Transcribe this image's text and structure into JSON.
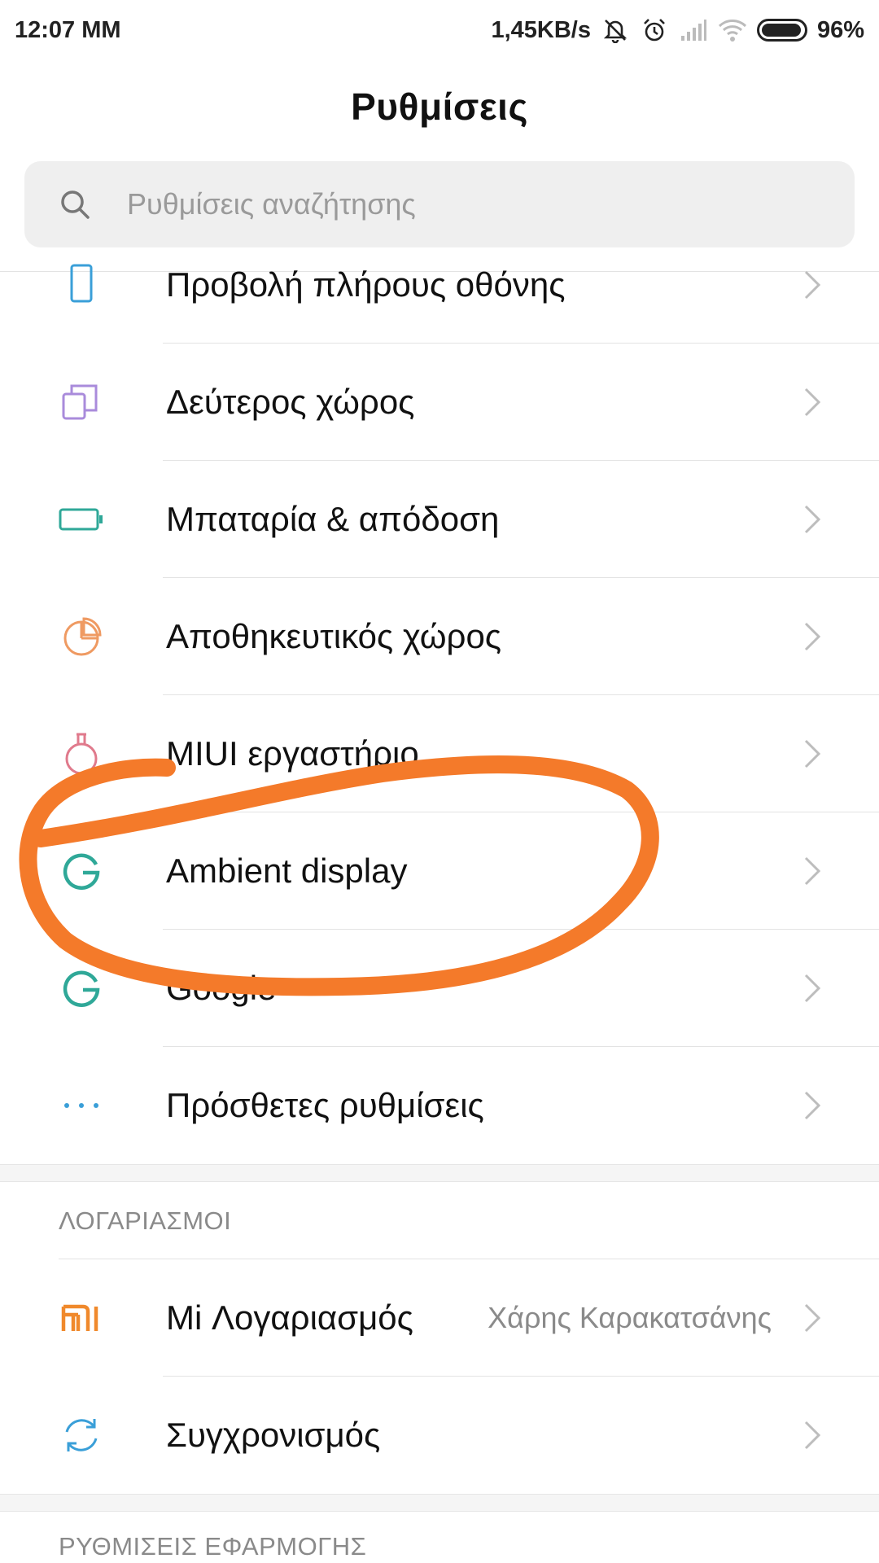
{
  "status_bar": {
    "time": "12:07 ΜΜ",
    "net_speed": "1,45KB/s",
    "battery_percent": "96%",
    "battery_level": 0.96
  },
  "page": {
    "title": "Ρυθμίσεις"
  },
  "search": {
    "placeholder": "Ρυθμίσεις αναζήτησης"
  },
  "items": [
    {
      "label": "Προβολή πλήρους οθόνης",
      "icon": "phone-screen-icon",
      "color": "#3a9fd8"
    },
    {
      "label": "Δεύτερος χώρος",
      "icon": "second-space-icon",
      "color": "#a98bdb"
    },
    {
      "label": "Μπαταρία & απόδοση",
      "icon": "battery-icon",
      "color": "#2fa898"
    },
    {
      "label": "Αποθηκευτικός χώρος",
      "icon": "storage-pie-icon",
      "color": "#ef9a62"
    },
    {
      "label": "MIUI εργαστήριο",
      "icon": "lab-flask-icon",
      "color": "#e07a8c"
    },
    {
      "label": "Ambient display",
      "icon": "google-g-icon",
      "color": "#2fa898"
    },
    {
      "label": "Google",
      "icon": "google-g-icon",
      "color": "#2fa898"
    },
    {
      "label": "Πρόσθετες ρυθμίσεις",
      "icon": "more-dots-icon",
      "color": "#3a9fd8"
    }
  ],
  "accounts_section": {
    "header": "ΛΟΓΑΡΙΑΣΜΟΙ",
    "items": [
      {
        "label": "Mi Λογαριασμός",
        "value": "Χάρης Καρακατσάνης",
        "icon": "mi-logo-icon",
        "color": "#f0892c"
      },
      {
        "label": "Συγχρονισμός",
        "icon": "sync-icon",
        "color": "#3a9fd8"
      }
    ]
  },
  "app_settings_section": {
    "header": "ΡΥΘΜΙΣΕΙΣ ΕΦΑΡΜΟΓΗΣ"
  },
  "annotation": {
    "color": "#f47a2a",
    "target": "Ambient display"
  }
}
